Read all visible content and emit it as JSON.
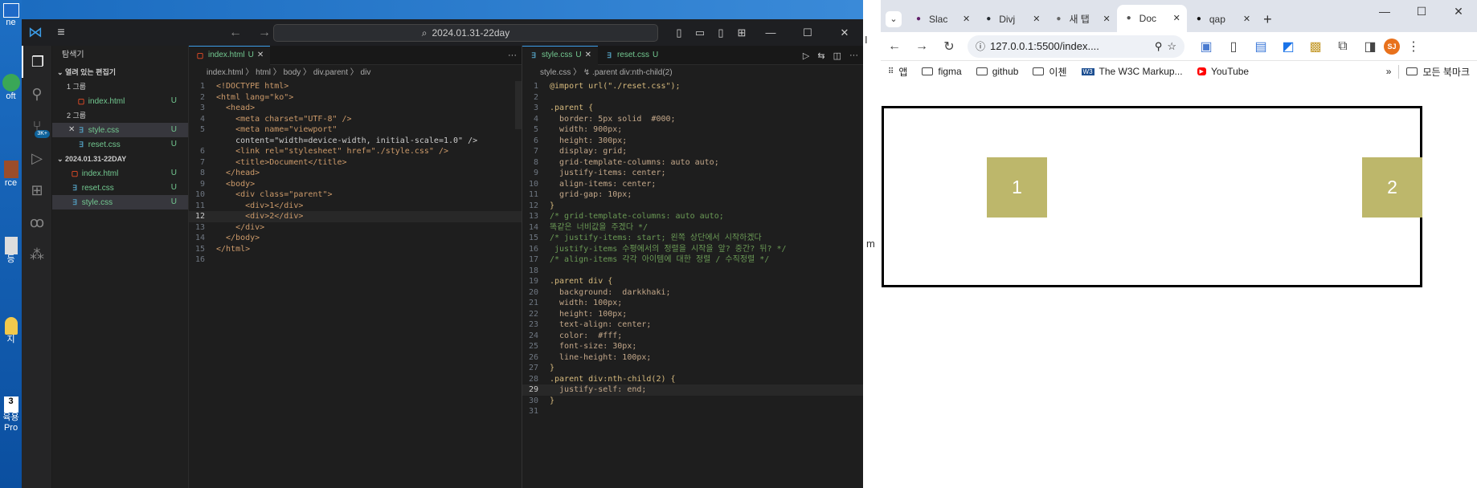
{
  "desktop": {
    "icons": [
      {
        "label": "ne"
      },
      {
        "label": "oft"
      },
      {
        "label": "rce"
      },
      {
        "label": "등"
      },
      {
        "label": "지"
      },
      {
        "label": "육용"
      },
      {
        "label": "Pro"
      }
    ]
  },
  "gap_text": {
    "f1": "I",
    "f2": "m"
  },
  "vscode": {
    "title": "2024.01.31-22day",
    "explorer": {
      "header": "탐색기",
      "open_editors": "열려 있는 편집기",
      "group1": "1 그룹",
      "group2": "2 그룹",
      "folder": "2024.01.31-22DAY",
      "g1": [
        {
          "name": "index.html",
          "status": "U",
          "kind": "html"
        }
      ],
      "g2": [
        {
          "name": "style.css",
          "status": "U",
          "kind": "css"
        },
        {
          "name": "reset.css",
          "status": "U",
          "kind": "css"
        }
      ],
      "files": [
        {
          "name": "index.html",
          "status": "U",
          "kind": "html"
        },
        {
          "name": "reset.css",
          "status": "U",
          "kind": "css"
        },
        {
          "name": "style.css",
          "status": "U",
          "kind": "css"
        }
      ]
    },
    "editor1": {
      "tab": "index.html",
      "tab_status": "U",
      "breadcrumb": "index.html  〉 html 〉 body 〉 div.parent 〉 div",
      "lines": [
        {
          "n": "1",
          "t": "<!DOCTYPE html>"
        },
        {
          "n": "2",
          "t": "<html lang=\"ko\">"
        },
        {
          "n": "3",
          "t": "  <head>"
        },
        {
          "n": "4",
          "t": "    <meta charset=\"UTF-8\" />"
        },
        {
          "n": "5",
          "t": "    <meta name=\"viewport\""
        },
        {
          "n": "",
          "t": "    content=\"width=device-width, initial-scale=1.0\" />"
        },
        {
          "n": "6",
          "t": "    <link rel=\"stylesheet\" href=\"./style.css\" />"
        },
        {
          "n": "7",
          "t": "    <title>Document</title>"
        },
        {
          "n": "8",
          "t": "  </head>"
        },
        {
          "n": "9",
          "t": "  <body>"
        },
        {
          "n": "10",
          "t": "    <div class=\"parent\">"
        },
        {
          "n": "11",
          "t": "      <div>1</div>"
        },
        {
          "n": "12",
          "t": "      <div>2</div>"
        },
        {
          "n": "13",
          "t": "    </div>"
        },
        {
          "n": "14",
          "t": "  </body>"
        },
        {
          "n": "15",
          "t": "</html>"
        },
        {
          "n": "16",
          "t": ""
        }
      ]
    },
    "editor2": {
      "tab1": "style.css",
      "tab1_status": "U",
      "tab2": "reset.css",
      "tab2_status": "U",
      "breadcrumb": "style.css 〉 ↯ .parent div:nth-child(2)",
      "lines": [
        {
          "n": "1",
          "t": "@import url(\"./reset.css\");"
        },
        {
          "n": "2",
          "t": ""
        },
        {
          "n": "3",
          "t": ".parent {"
        },
        {
          "n": "4",
          "t": "  border: 5px solid  #000;"
        },
        {
          "n": "5",
          "t": "  width: 900px;"
        },
        {
          "n": "6",
          "t": "  height: 300px;"
        },
        {
          "n": "7",
          "t": "  display: grid;"
        },
        {
          "n": "8",
          "t": "  grid-template-columns: auto auto;"
        },
        {
          "n": "9",
          "t": "  justify-items: center;"
        },
        {
          "n": "10",
          "t": "  align-items: center;"
        },
        {
          "n": "11",
          "t": "  grid-gap: 10px;"
        },
        {
          "n": "12",
          "t": "}"
        },
        {
          "n": "13",
          "t": "/* grid-template-columns: auto auto;"
        },
        {
          "n": "14",
          "t": "똑같은 너비값을 주겠다 */"
        },
        {
          "n": "15",
          "t": "/* justify-items: start; 왼쪽 상단에서 시작하겠다"
        },
        {
          "n": "16",
          "t": " justify-items 수평에서의 정렬을 시작을 앞? 중간? 뒤? */"
        },
        {
          "n": "17",
          "t": "/* align-items 각각 아이템에 대한 정렬 / 수직정렬 */"
        },
        {
          "n": "18",
          "t": ""
        },
        {
          "n": "19",
          "t": ".parent div {"
        },
        {
          "n": "20",
          "t": "  background:  darkkhaki;"
        },
        {
          "n": "21",
          "t": "  width: 100px;"
        },
        {
          "n": "22",
          "t": "  height: 100px;"
        },
        {
          "n": "23",
          "t": "  text-align: center;"
        },
        {
          "n": "24",
          "t": "  color:  #fff;"
        },
        {
          "n": "25",
          "t": "  font-size: 30px;"
        },
        {
          "n": "26",
          "t": "  line-height: 100px;"
        },
        {
          "n": "27",
          "t": "}"
        },
        {
          "n": "28",
          "t": ".parent div:nth-child(2) {"
        },
        {
          "n": "29",
          "t": "  justify-self: end;"
        },
        {
          "n": "30",
          "t": "}"
        },
        {
          "n": "31",
          "t": ""
        }
      ]
    }
  },
  "browser": {
    "tabs": [
      {
        "label": "Slac",
        "icon": "slack-icon",
        "color": "#611f69"
      },
      {
        "label": "Divj",
        "icon": "github-icon",
        "color": "#24292f"
      },
      {
        "label": "새 탭",
        "icon": "chrome-icon",
        "color": "#666"
      },
      {
        "label": "Doc",
        "icon": "globe-icon",
        "color": "#555"
      },
      {
        "label": "qap",
        "icon": "notion-icon",
        "color": "#111"
      }
    ],
    "url": "127.0.0.1:5500/index....",
    "profile": "SJ",
    "bookmarks": [
      {
        "label": "앱"
      },
      {
        "label": "figma"
      },
      {
        "label": "github"
      },
      {
        "label": "이첸"
      },
      {
        "label": "The W3C Markup..."
      },
      {
        "label": "YouTube"
      }
    ],
    "all_bookmarks": "모든 북마크",
    "page": {
      "items": [
        "1",
        "2"
      ],
      "bg": "#bdb76b"
    }
  }
}
